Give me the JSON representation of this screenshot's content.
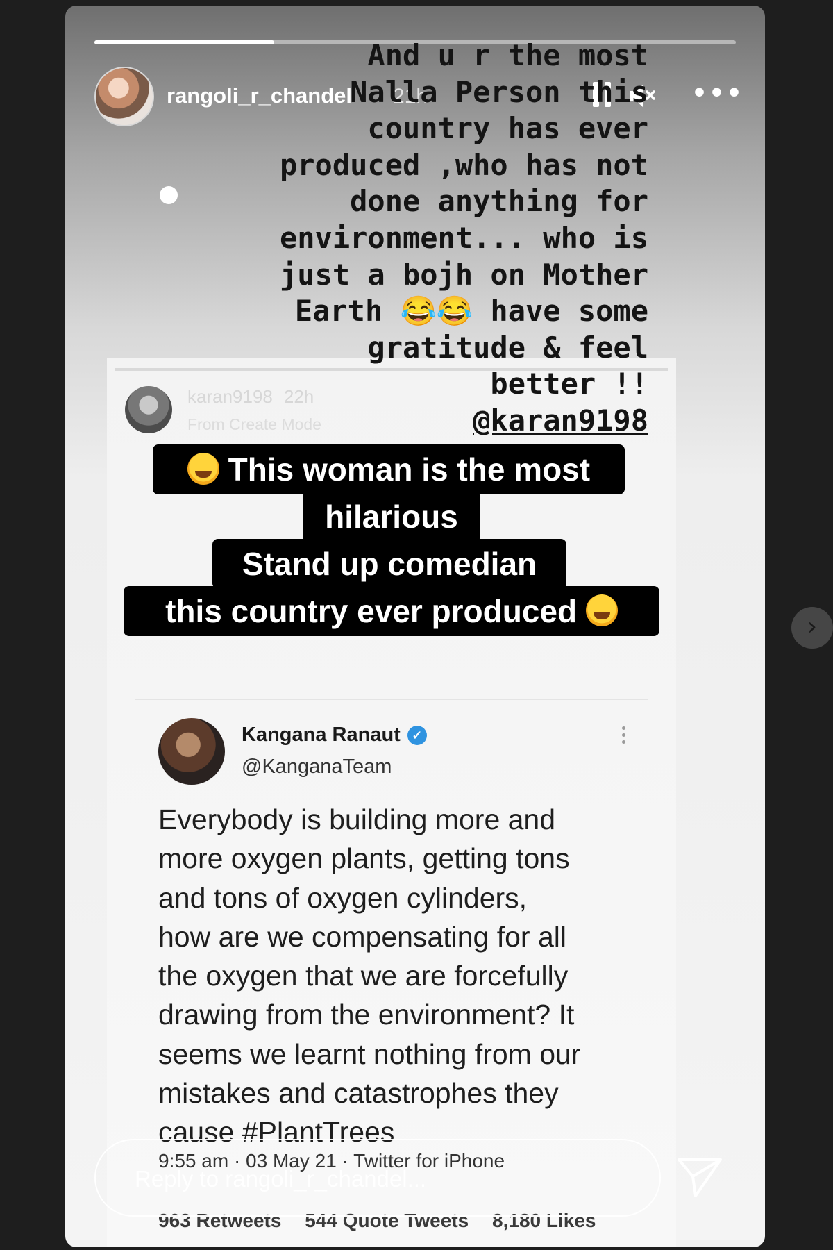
{
  "story": {
    "progress": 0.28,
    "username": "rangoli_r_chandel",
    "time": "21h",
    "caption": {
      "lines": [
        "And u r the most",
        "Nalla  Person this",
        "country has ever",
        "produced ,who has not",
        "done anything for",
        "environment... who is",
        "just a bojh on Mother",
        "Earth 😂😂 have some",
        "gratitude & feel",
        "better !!"
      ],
      "mention": "@karan9198"
    },
    "reply_placeholder": "Reply to rangoli_r_chandel..."
  },
  "inner_story": {
    "username": "karan9198",
    "time": "22h",
    "mode": "From Create Mode",
    "sticker_lines": [
      "This woman is the most",
      "hilarious",
      "Stand up comedian",
      "this country ever produced"
    ]
  },
  "tweet": {
    "name": "Kangana Ranaut",
    "handle": "@KanganaTeam",
    "text_lines": [
      "Everybody is building more and",
      "more oxygen plants, getting tons",
      "and tons of oxygen cylinders,",
      "how are we compensating for all",
      "the oxygen that we are forcefully",
      "drawing from the environment? It",
      "seems we learnt nothing from our",
      "mistakes and catastrophes they",
      "cause #PlantTrees"
    ],
    "meta": "9:55 am · 03 May 21 · Twitter for iPhone",
    "stats": {
      "retweets": "963 Retweets",
      "quote_tweets": "544 Quote Tweets",
      "likes": "8,180 Likes"
    }
  },
  "icons": {
    "pause": "pause-icon",
    "mute": "speaker-muted-icon",
    "more": "more-horizontal-icon",
    "send": "send-icon",
    "next": "chevron-right-icon",
    "verified": "verified-badge-icon"
  }
}
